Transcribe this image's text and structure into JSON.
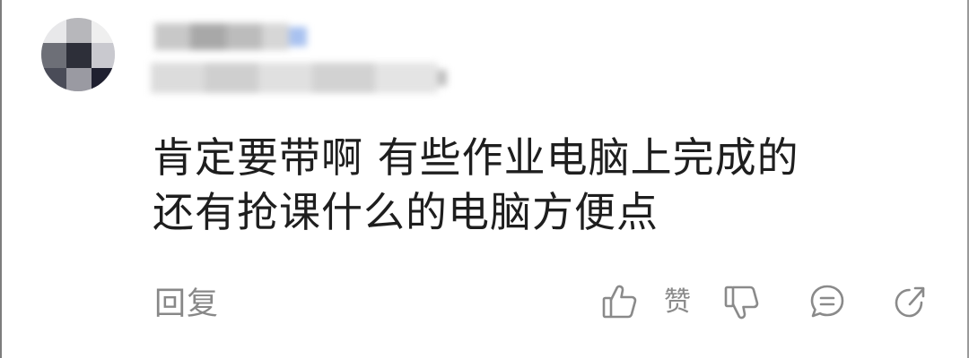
{
  "comment": {
    "lines": [
      "肯定要带啊 有些作业电脑上完成的",
      "还有抢课什么的电脑方便点"
    ]
  },
  "actions": {
    "reply_label": "回复",
    "like_label": "赞"
  },
  "icons": {
    "like": "thumbs-up-icon",
    "dislike": "thumbs-down-icon",
    "comment": "comment-bubble-icon",
    "share": "share-icon"
  },
  "colors": {
    "text": "#1e1e1e",
    "muted": "#888888",
    "icon": "#8a8a8a"
  }
}
